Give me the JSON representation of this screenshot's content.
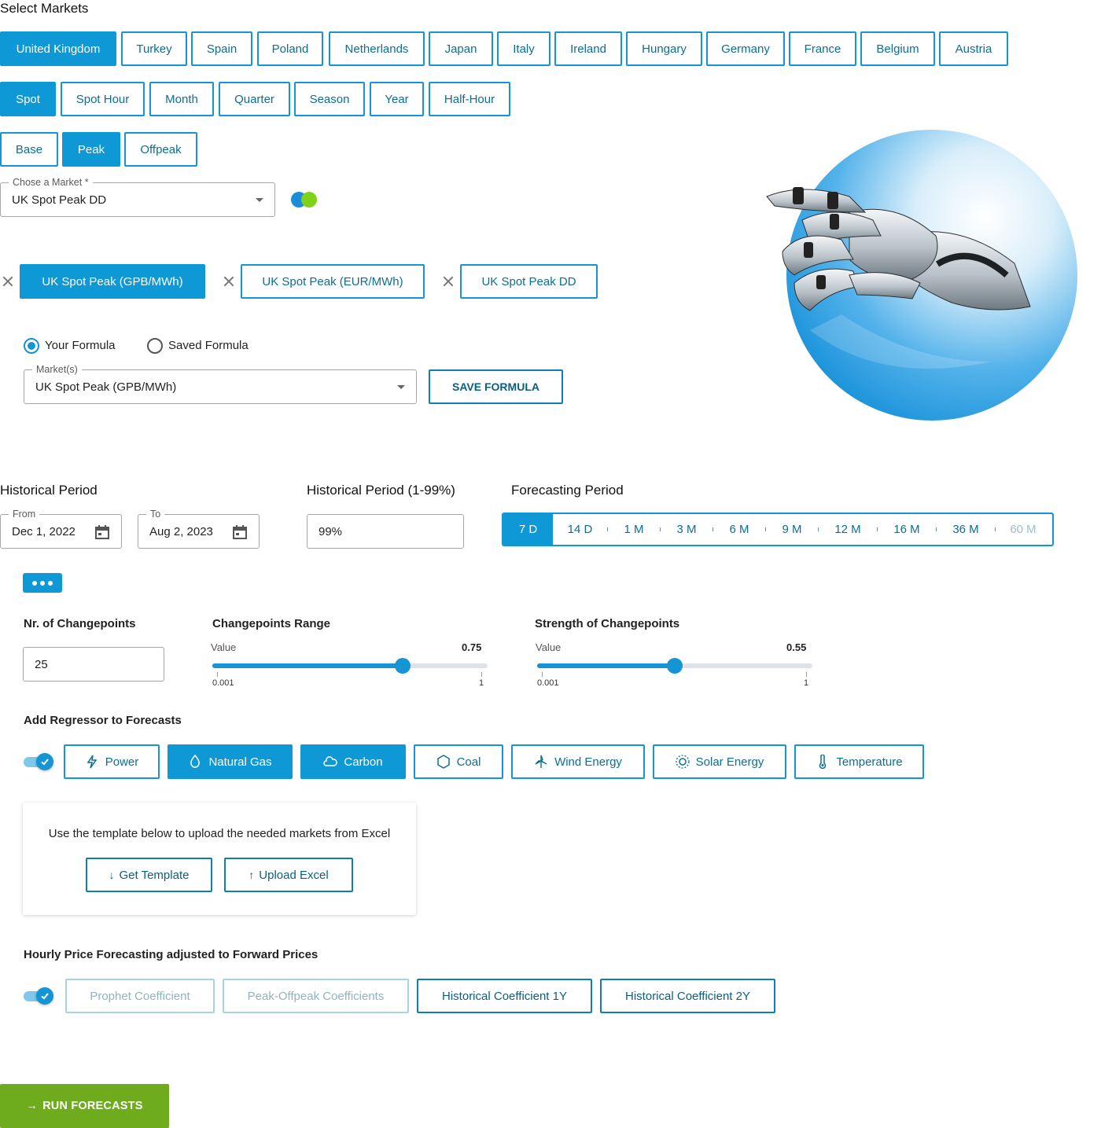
{
  "select_markets": {
    "title": "Select Markets",
    "countries": [
      "United Kingdom",
      "Turkey",
      "Spain",
      "Poland",
      "Netherlands",
      "Japan",
      "Italy",
      "Ireland",
      "Hungary",
      "Germany",
      "France",
      "Belgium",
      "Austria"
    ],
    "active_country": "United Kingdom",
    "products": [
      "Spot",
      "Spot Hour",
      "Month",
      "Quarter",
      "Season",
      "Year",
      "Half-Hour"
    ],
    "active_product": "Spot",
    "loads": [
      "Base",
      "Peak",
      "Offpeak"
    ],
    "active_load": "Peak"
  },
  "market_select": {
    "label": "Chose a Market *",
    "value": "UK Spot Peak DD"
  },
  "chips": [
    {
      "label": "UK Spot Peak (GPB/MWh)",
      "active": true
    },
    {
      "label": "UK Spot Peak (EUR/MWh)",
      "active": false
    },
    {
      "label": "UK Spot Peak DD",
      "active": false
    }
  ],
  "formula": {
    "your_formula": "Your Formula",
    "saved_formula": "Saved Formula",
    "selected": "Your Formula",
    "markets_label": "Market(s)",
    "markets_value": "UK Spot Peak (GPB/MWh)",
    "save_button": "SAVE FORMULA"
  },
  "historical_period": {
    "title": "Historical Period",
    "from_label": "From",
    "from_value": "Dec 1, 2022",
    "to_label": "To",
    "to_value": "Aug 2, 2023"
  },
  "historical_pct": {
    "title": "Historical Period",
    "title_suffix": "(1-99%)",
    "value": "99%"
  },
  "forecasting_period": {
    "title": "Forecasting Period",
    "options": [
      "7 D",
      "14 D",
      "1 M",
      "3 M",
      "6 M",
      "9 M",
      "12 M",
      "16 M",
      "36 M",
      "60 M"
    ],
    "active": "7 D",
    "disabled": [
      "60 M"
    ]
  },
  "changepoints": {
    "nr_title": "Nr. of Changepoints",
    "nr_value": "25",
    "range_title": "Changepoints Range",
    "range_value_label": "Value",
    "range_value": "0.75",
    "range_min": "0.001",
    "range_max": "1",
    "range_fraction": 0.75,
    "strength_title": "Strength of Changepoints",
    "strength_value_label": "Value",
    "strength_value": "0.55",
    "strength_min": "0.001",
    "strength_max": "1",
    "strength_fraction": 0.55
  },
  "regressor": {
    "title": "Add Regressor to Forecasts",
    "toggle_on": true,
    "items": [
      {
        "label": "Power",
        "icon": "lightning-icon",
        "active": false
      },
      {
        "label": "Natural Gas",
        "icon": "drop-icon",
        "active": true
      },
      {
        "label": "Carbon",
        "icon": "cloud-icon",
        "active": true
      },
      {
        "label": "Coal",
        "icon": "hexagon-icon",
        "active": false
      },
      {
        "label": "Wind Energy",
        "icon": "wind-turbine-icon",
        "active": false
      },
      {
        "label": "Solar Energy",
        "icon": "sun-icon",
        "active": false
      },
      {
        "label": "Temperature",
        "icon": "thermometer-icon",
        "active": false
      }
    ]
  },
  "upload": {
    "text": "Use the template below to upload the needed markets from Excel",
    "get_template": "Get Template",
    "upload_excel": "Upload Excel"
  },
  "hourly": {
    "title": "Hourly Price Forecasting adjusted to Forward Prices",
    "toggle_on": true,
    "items": [
      {
        "label": "Prophet Coefficient",
        "state": "disabled"
      },
      {
        "label": "Peak-Offpeak Coefficients",
        "state": "disabled"
      },
      {
        "label": "Historical Coefficient 1Y",
        "state": "enabled"
      },
      {
        "label": "Historical Coefficient 2Y",
        "state": "enabled"
      }
    ]
  },
  "run_button": "RUN FORECASTS",
  "colors": {
    "accent": "#0e98d6",
    "run": "#6eac1e",
    "dot_blue": "#1a8ed8",
    "dot_green": "#7fd11a"
  }
}
